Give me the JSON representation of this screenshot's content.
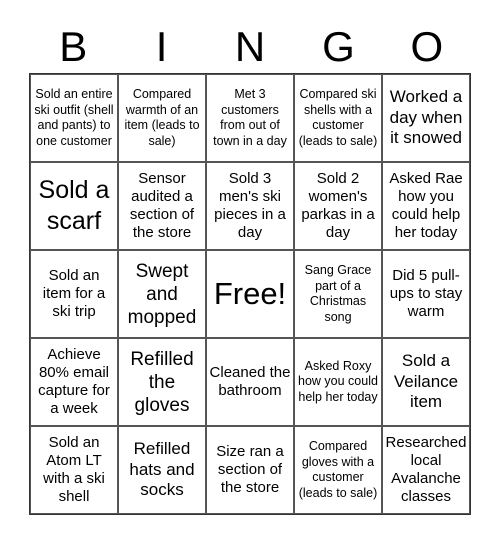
{
  "header": {
    "letters": [
      "B",
      "I",
      "N",
      "G",
      "O"
    ]
  },
  "cells": [
    "Sold an entire ski outfit (shell and pants) to one customer",
    "Compared warmth of an item (leads to sale)",
    "Met 3 customers from out of town in a day",
    "Compared ski shells with a customer (leads to sale)",
    "Worked a day when it snowed",
    "Sold a scarf",
    "Sensor audited a section of the store",
    "Sold 3 men's ski pieces in a day",
    "Sold 2 women's parkas in a day",
    "Asked Rae how you could help her today",
    "Sold an item for a ski trip",
    "Swept and mopped",
    "Free!",
    "Sang Grace part of a Christmas song",
    "Did 5 pull-ups to stay warm",
    "Achieve 80% email capture for a week",
    "Refilled the gloves",
    "Cleaned the bathroom",
    "Asked Roxy how you could help her today",
    "Sold a Veilance item",
    "Sold an Atom LT with a ski shell",
    "Refilled hats and socks",
    "Size ran a section of the store",
    "Compared gloves with a customer (leads to sale)",
    "Researched local Avalanche classes"
  ]
}
